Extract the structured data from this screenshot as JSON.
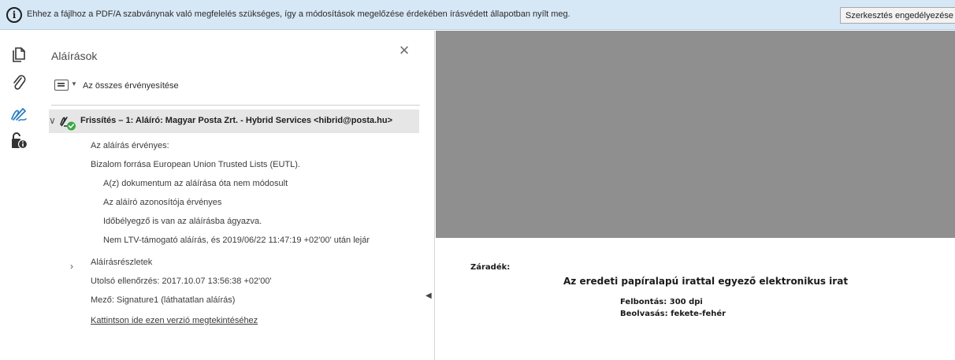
{
  "infobar": {
    "message": "Ehhez a fájlhoz a PDF/A szabványnak való megfelelés szükséges, így a módosítások megelőzése érdekében írásvédett állapotban nyílt meg.",
    "enable_editing_label": "Szerkesztés engedélyezése"
  },
  "rail": {
    "icons": [
      "pages-icon",
      "attachments-icon",
      "signatures-icon",
      "security-icon"
    ]
  },
  "panel": {
    "title": "Aláírások",
    "validate_all_label": "Az összes érvényesítése",
    "signature": {
      "title": "Frissítés – 1: Aláíró: Magyar Posta Zrt. - Hybrid Services <hibrid@posta.hu>",
      "details": [
        "Az aláírás érvényes:",
        "Bizalom forrása European Union Trusted Lists (EUTL).",
        "A(z) dokumentum az aláírása óta nem módosult",
        "Az aláíró azonosítója érvényes",
        "Időbélyegző is van az aláírásba ágyazva.",
        "Nem LTV-támogató aláírás, és 2019/06/22 11:47:19 +02'00' után lejár"
      ],
      "details_toggle": "Aláírásrészletek",
      "last_checked": "Utolsó ellenőrzés: 2017.10.07 13:56:38 +02'00'",
      "field": "Mező: Signature1 (láthatatlan aláírás)",
      "view_version_link": "Kattintson ide ezen verzió megtekintéséhez"
    }
  },
  "document": {
    "clause_label": "Záradék:",
    "heading": "Az eredeti papíralapú irattal egyező elektronikus irat",
    "resolution": "Felbontás: 300 dpi",
    "scan_mode": "Beolvasás: fekete-fehér"
  },
  "colors": {
    "infobar_bg": "#d6e7f6",
    "doc_gray": "#8f8f8f",
    "valid_green": "#3aa845"
  }
}
